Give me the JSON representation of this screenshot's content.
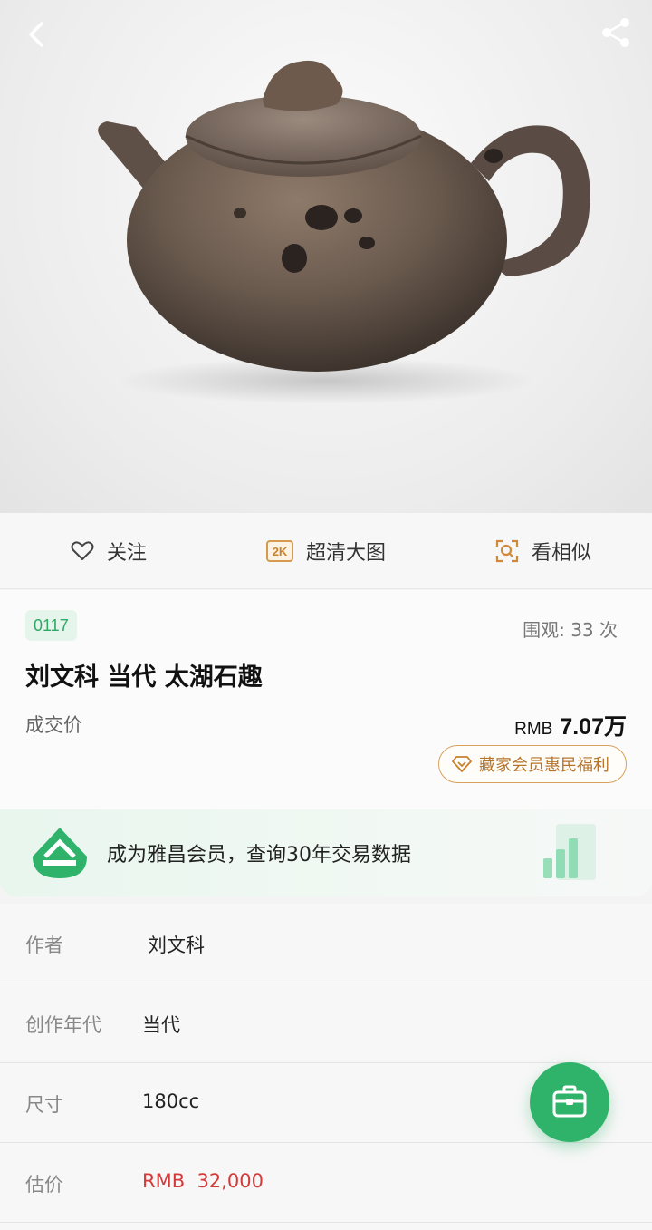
{
  "actions": {
    "follow_label": "关注",
    "hd_badge": "2K",
    "hd_label": "超清大图",
    "similar_label": "看相似"
  },
  "lot": {
    "number": "0117",
    "views": "围观: 33 次",
    "title": "刘文科 当代 太湖石趣",
    "deal_label": "成交价",
    "price_currency": "RMB",
    "price_value": "7.07万",
    "vip_label": "藏家会员惠民福利"
  },
  "member_banner": {
    "text": "成为雅昌会员，查询30年交易数据"
  },
  "details": [
    {
      "key": "作者",
      "value": "刘文科"
    },
    {
      "key": "创作年代",
      "value": "当代"
    },
    {
      "key": "尺寸",
      "value": "180cc"
    },
    {
      "key": "估价",
      "value": "RMB  32,000"
    }
  ],
  "colors": {
    "accent_green": "#2fb36a",
    "estimate_red": "#d33a3a",
    "vip_gold": "#d7a15c"
  },
  "icons": {
    "back": "chevron-left-icon",
    "share": "share-icon",
    "follow": "heart-outline-icon",
    "hd": "2k-icon",
    "similar": "image-search-icon",
    "vip": "diamond-icon",
    "fab": "briefcase-icon"
  }
}
